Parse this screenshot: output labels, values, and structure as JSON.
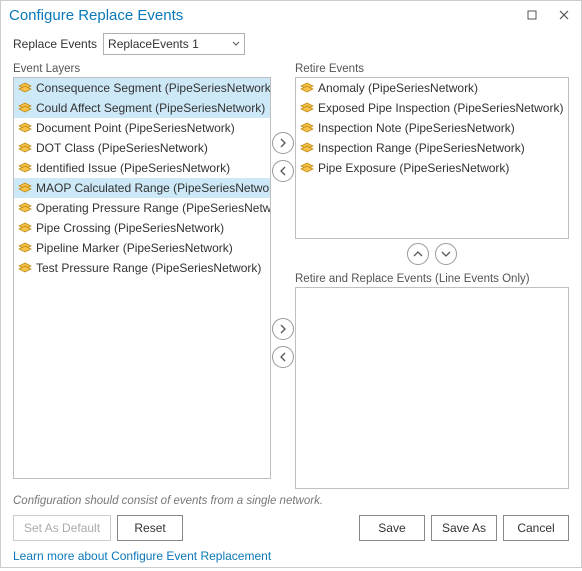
{
  "title": "Configure Replace Events",
  "replace_events": {
    "label": "Replace Events",
    "value": "ReplaceEvents 1"
  },
  "panels": {
    "event_layers": {
      "label": "Event Layers",
      "items": [
        {
          "label": "Consequence Segment (PipeSeriesNetwork)",
          "selected": true
        },
        {
          "label": "Could Affect Segment (PipeSeriesNetwork)",
          "selected": true
        },
        {
          "label": "Document Point (PipeSeriesNetwork)",
          "selected": false
        },
        {
          "label": "DOT Class (PipeSeriesNetwork)",
          "selected": false
        },
        {
          "label": "Identified Issue (PipeSeriesNetwork)",
          "selected": false
        },
        {
          "label": "MAOP Calculated Range (PipeSeriesNetwork)",
          "selected": true
        },
        {
          "label": "Operating Pressure Range (PipeSeriesNetwork)",
          "selected": false
        },
        {
          "label": "Pipe Crossing (PipeSeriesNetwork)",
          "selected": false
        },
        {
          "label": "Pipeline Marker (PipeSeriesNetwork)",
          "selected": false
        },
        {
          "label": "Test Pressure Range (PipeSeriesNetwork)",
          "selected": false
        }
      ]
    },
    "retire_events": {
      "label": "Retire Events",
      "items": [
        {
          "label": "Anomaly (PipeSeriesNetwork)"
        },
        {
          "label": "Exposed Pipe Inspection (PipeSeriesNetwork)"
        },
        {
          "label": "Inspection Note (PipeSeriesNetwork)"
        },
        {
          "label": "Inspection Range (PipeSeriesNetwork)"
        },
        {
          "label": "Pipe Exposure (PipeSeriesNetwork)"
        }
      ]
    },
    "retire_replace_events": {
      "label": "Retire and Replace Events (Line Events Only)",
      "items": []
    }
  },
  "hint": "Configuration should consist of events from a single network.",
  "buttons": {
    "set_as_default": "Set As Default",
    "reset": "Reset",
    "save": "Save",
    "save_as": "Save As",
    "cancel": "Cancel"
  },
  "learn_more": "Learn more about Configure Event Replacement",
  "icons": {
    "layer": "layer-icon"
  }
}
